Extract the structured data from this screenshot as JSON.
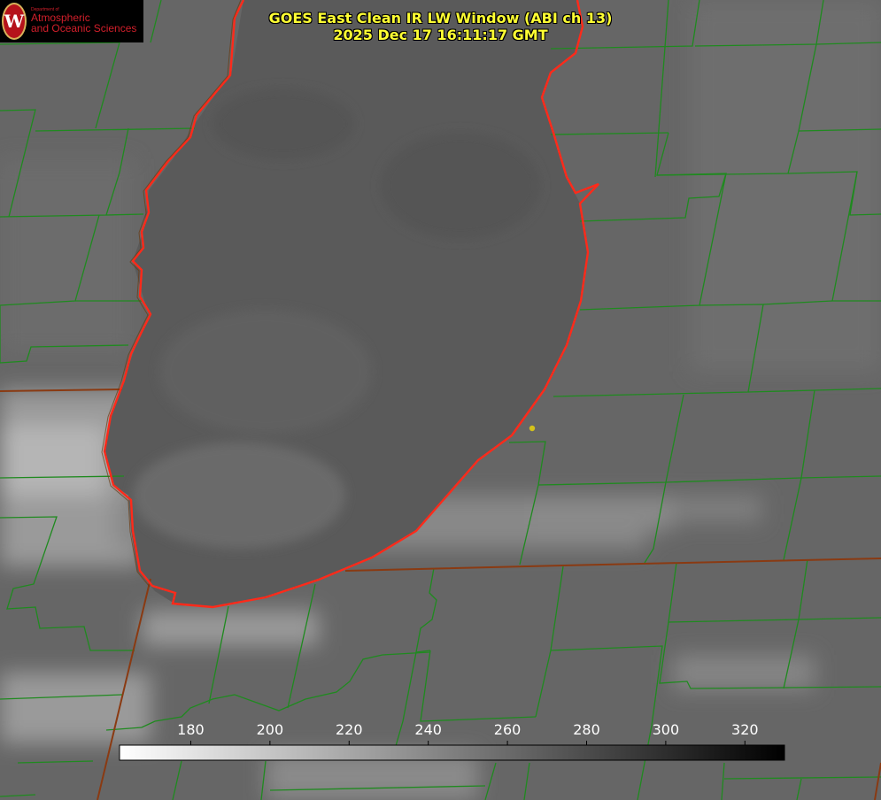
{
  "header": {
    "title_line1": "GOES East Clean IR LW Window (ABI ch 13)",
    "title_line2": "2025 Dec 17 16:11:17 GMT"
  },
  "logo": {
    "dept_text": "Department of",
    "line1": "Atmospheric",
    "line2": "and Oceanic Sciences",
    "seal_letter": "W"
  },
  "colorbar": {
    "ticks": [
      "180",
      "200",
      "220",
      "240",
      "260",
      "280",
      "300",
      "320"
    ],
    "range_min": 162,
    "range_max": 330,
    "colors": {
      "cold": "#ffffff",
      "warm": "#000000"
    }
  },
  "colors": {
    "lake_outline": "#ff2a1a",
    "county_lines": "#1f8a1f",
    "state_lines": "#8a3a12",
    "station_marker": "#d4c21a"
  }
}
